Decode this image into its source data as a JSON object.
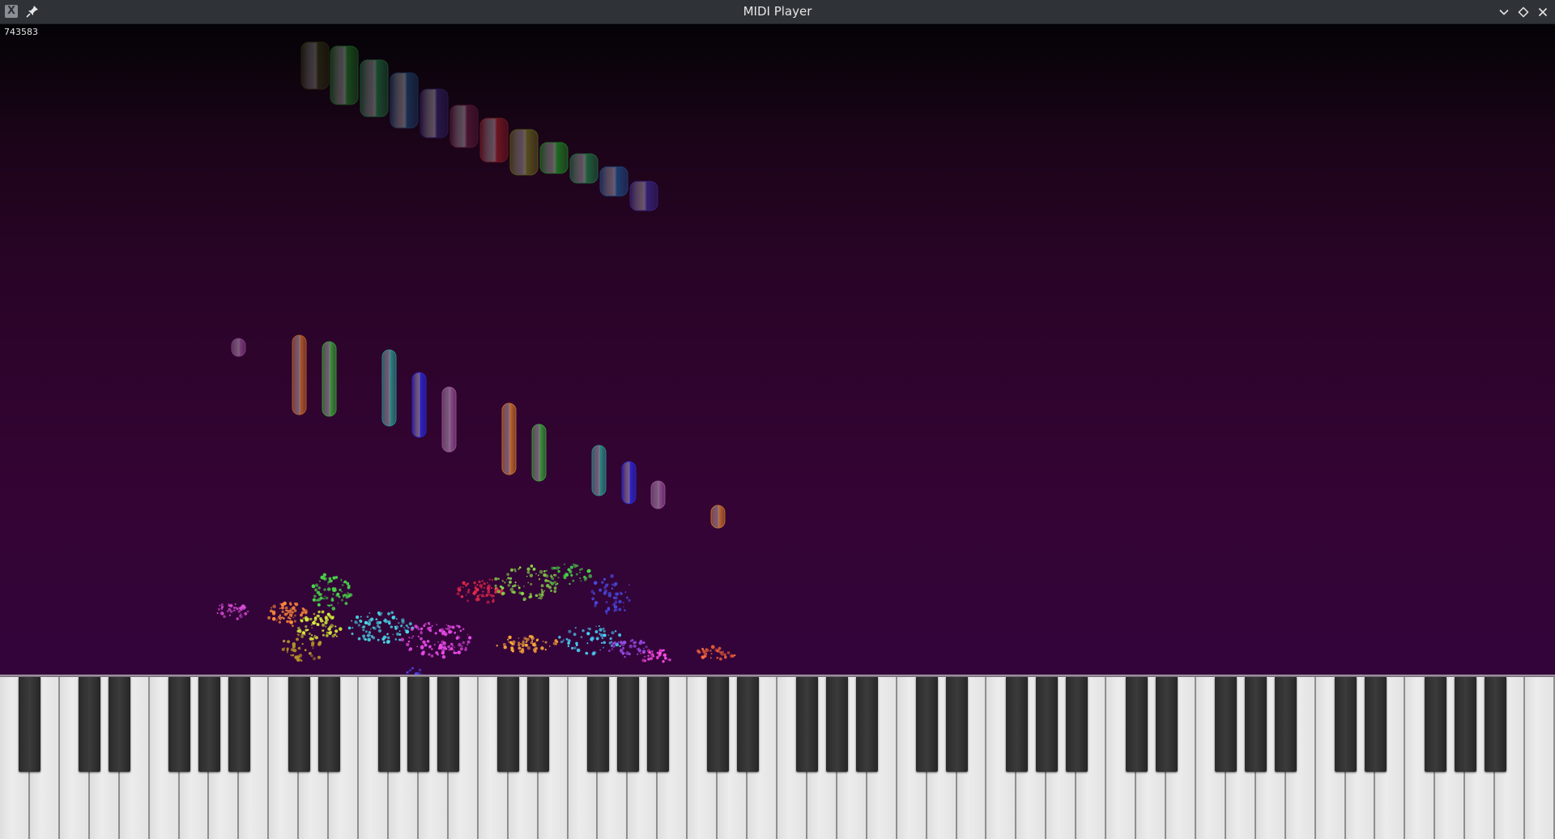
{
  "window": {
    "title": "MIDI Player",
    "app_icon": "x-app-icon",
    "pin_icon": "pin-icon",
    "controls": [
      "minimize-chevron-icon",
      "maximize-diamond-icon",
      "close-icon"
    ]
  },
  "player": {
    "counter": "743583"
  },
  "colors": {
    "title_bar": "#2f3337",
    "background_top": "#040306",
    "background_bottom": "#33043a",
    "white_key": "#e6e6e6",
    "black_key": "#2f2f2f"
  },
  "keyboard": {
    "white_key_count": 52,
    "visible_range": "A0-C8"
  }
}
